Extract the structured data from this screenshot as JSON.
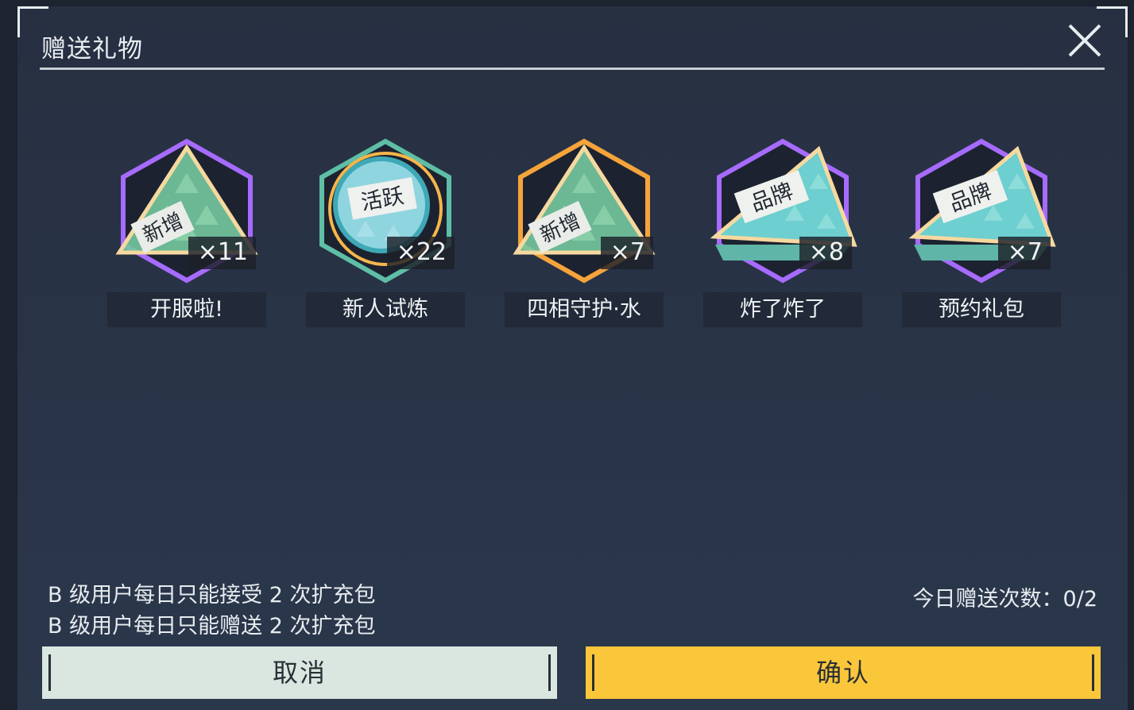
{
  "dialog": {
    "title": "赠送礼物",
    "close_icon": "close-icon"
  },
  "gifts": [
    {
      "name": "开服啦!",
      "count": "×11",
      "stamp": "新增",
      "frame": "#a66bff",
      "inner": "#76c9a0",
      "icon": "pyramid-gift-icon"
    },
    {
      "name": "新人试炼",
      "count": "×22",
      "stamp": "活跃",
      "frame": "#5fbea6",
      "inner": "#8fd5e0",
      "icon": "coin-gift-icon"
    },
    {
      "name": "四相守护·水",
      "count": "×7",
      "stamp": "新增",
      "frame": "#f5a43b",
      "inner": "#76c9a0",
      "icon": "pyramid-gift-icon"
    },
    {
      "name": "炸了炸了",
      "count": "×8",
      "stamp": "品牌",
      "frame": "#a66bff",
      "inner": "#6dcfcf",
      "icon": "book-gift-icon"
    },
    {
      "name": "预约礼包",
      "count": "×7",
      "stamp": "品牌",
      "frame": "#a66bff",
      "inner": "#6dcfcf",
      "icon": "book-gift-icon"
    }
  ],
  "rules": {
    "receive": "B 级用户每日只能接受 2 次扩充包",
    "send": "B 级用户每日只能赠送 2 次扩充包"
  },
  "send_count": "今日赠送次数：0/2",
  "buttons": {
    "cancel": "取消",
    "confirm": "确认"
  },
  "colors": {
    "panel": "#283245",
    "cancel_bg": "#d9e7e0",
    "confirm_bg": "#fbc73a"
  }
}
